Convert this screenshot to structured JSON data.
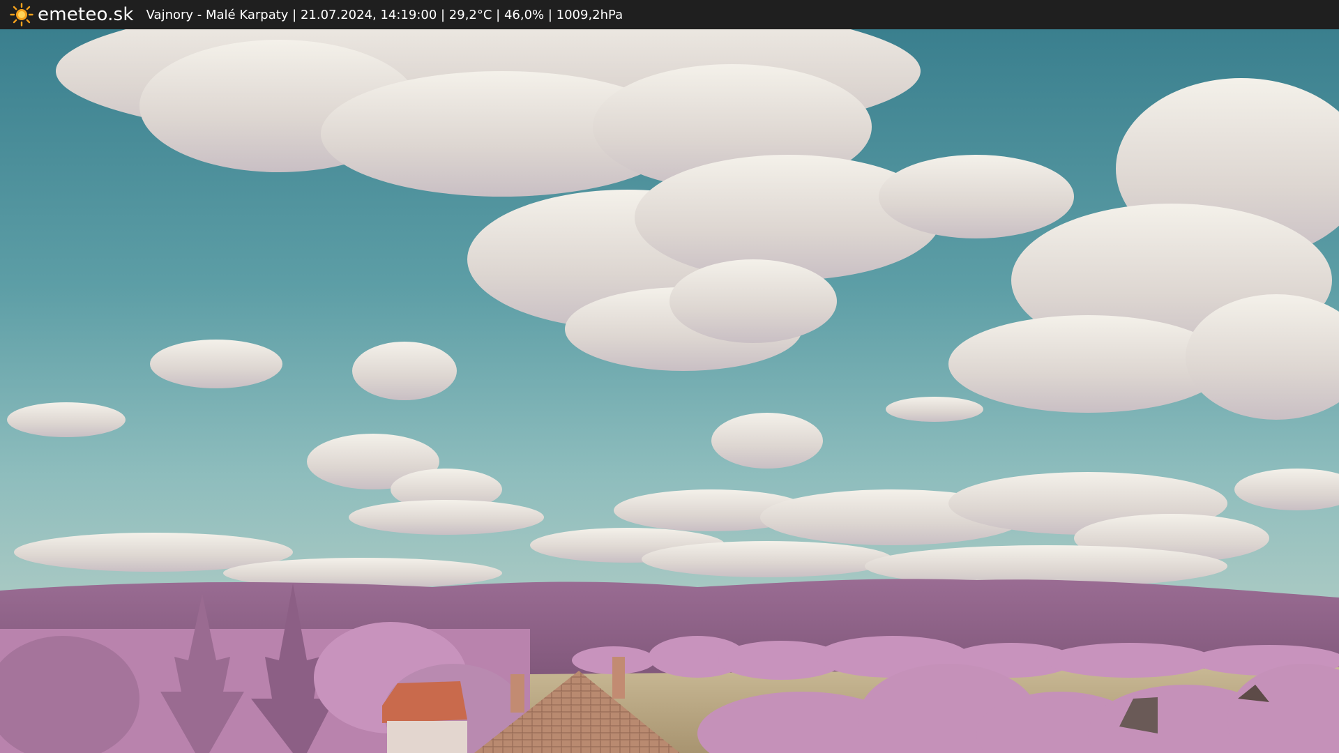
{
  "header": {
    "brand": "emeteo.sk",
    "caption": "Vajnory - Malé Karpaty | 21.07.2024, 14:19:00 | 29,2°C | 46,0% | 1009,2hPa",
    "logo_icon": "sun-icon",
    "background": "#1f1f1f"
  },
  "scene": {
    "description_colors": {
      "sky_top": "#3e8593",
      "sky_bottom": "#8fbcbd",
      "hills": "#8a5a83",
      "foliage": "#c98fbd",
      "field": "#bba884",
      "roof": "#c96a4c"
    }
  }
}
